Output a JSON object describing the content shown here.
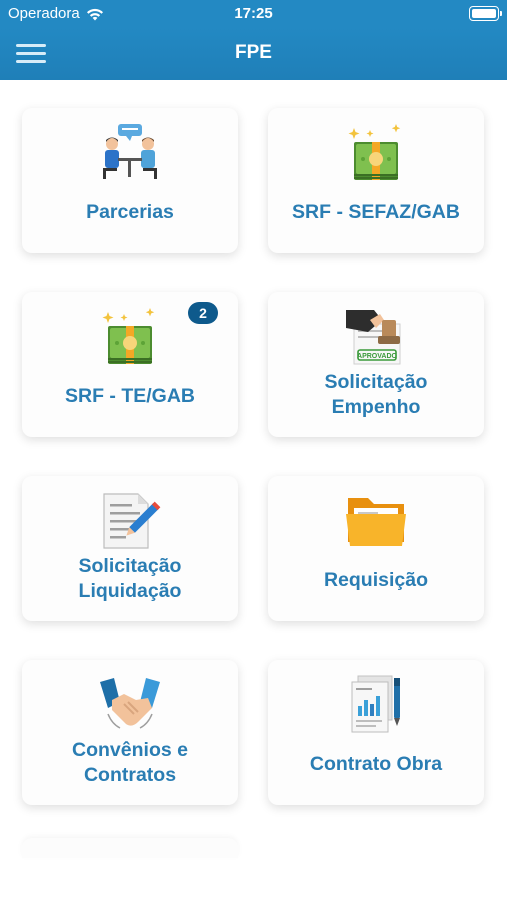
{
  "status_bar": {
    "carrier": "Operadora",
    "time": "17:25"
  },
  "nav": {
    "title": "FPE"
  },
  "cards": [
    {
      "label": "Parcerias",
      "icon": "meeting-icon"
    },
    {
      "label": "SRF - SEFAZ/GAB",
      "icon": "money-icon"
    },
    {
      "label": "SRF - TE/GAB",
      "icon": "money-icon",
      "badge": "2"
    },
    {
      "label_line1": "Solicitação",
      "label_line2": "Empenho",
      "icon": "approved-stamp-icon"
    },
    {
      "label_line1": "Solicitação",
      "label_line2": "Liquidação",
      "icon": "document-pen-icon"
    },
    {
      "label": "Requisição",
      "icon": "folder-icon"
    },
    {
      "label_line1": "Convênios e",
      "label_line2": "Contratos",
      "icon": "handshake-icon"
    },
    {
      "label": "Contrato Obra",
      "icon": "report-pen-icon"
    }
  ],
  "colors": {
    "accent": "#2389c3",
    "label": "#2a7db3",
    "badge": "#0e5a8c"
  }
}
